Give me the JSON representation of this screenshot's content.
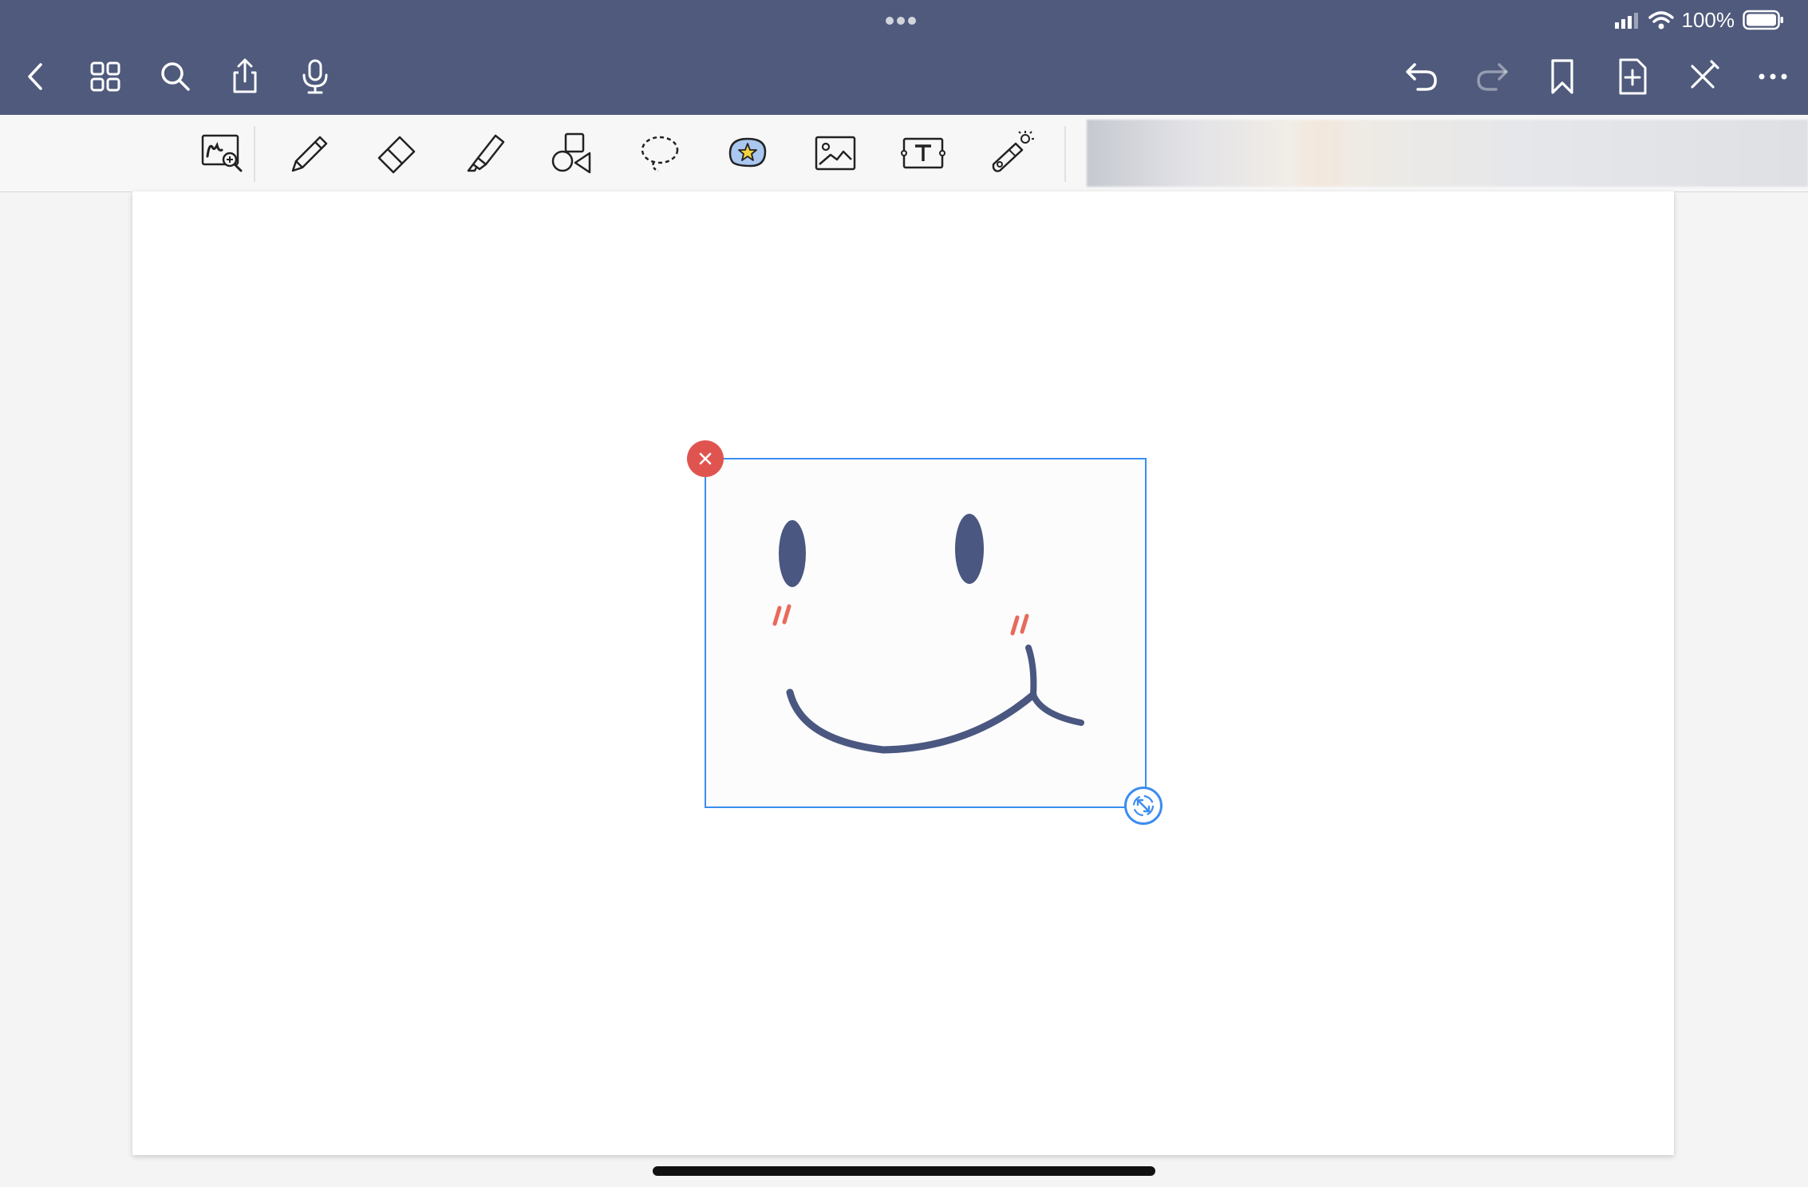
{
  "status_bar": {
    "battery_text": "100%"
  },
  "nav_left": [
    {
      "name": "back-icon"
    },
    {
      "name": "grid-view-icon"
    },
    {
      "name": "search-icon"
    },
    {
      "name": "share-icon"
    },
    {
      "name": "microphone-icon"
    }
  ],
  "nav_right": [
    {
      "name": "undo-icon"
    },
    {
      "name": "redo-icon",
      "state": "disabled"
    },
    {
      "name": "bookmark-icon"
    },
    {
      "name": "add-page-icon"
    },
    {
      "name": "exit-edit-icon"
    },
    {
      "name": "more-icon"
    }
  ],
  "tools": [
    {
      "name": "zoom-window-tool-icon"
    },
    {
      "name": "pen-tool-icon"
    },
    {
      "name": "eraser-tool-icon"
    },
    {
      "name": "highlighter-tool-icon"
    },
    {
      "name": "shapes-tool-icon"
    },
    {
      "name": "lasso-tool-icon"
    },
    {
      "name": "sticker-tool-icon",
      "state": "selected"
    },
    {
      "name": "image-tool-icon"
    },
    {
      "name": "text-tool-icon"
    },
    {
      "name": "laser-pointer-tool-icon"
    }
  ],
  "colors": {
    "header": "#4f5a7c",
    "selection": "#3b8df0",
    "delete": "#e05450",
    "sticker_face": "#4a5780",
    "sticker_blush": "#e86a5a",
    "active_tool_fill": "#a9c7ef"
  },
  "canvas": {
    "selected_item": "sticker",
    "sticker_content": "smiley-face"
  }
}
